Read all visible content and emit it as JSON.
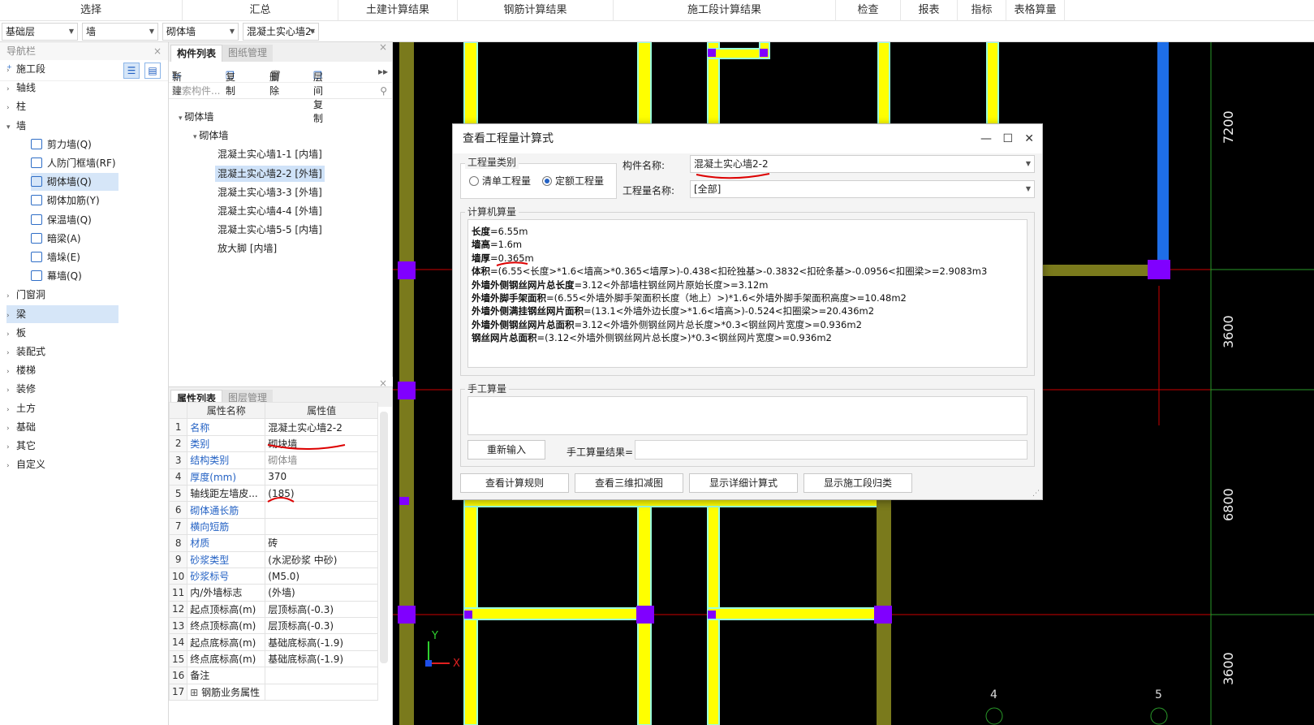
{
  "ribbon": [
    "选择",
    "汇总",
    "土建计算结果",
    "钢筋计算结果",
    "施工段计算结果",
    "检查",
    "报表",
    "指标",
    "表格算量"
  ],
  "selectors": [
    "基础层",
    "墙",
    "砌体墙",
    "混凝土实心墙2-"
  ],
  "nav": {
    "title": "导航栏",
    "items": [
      "施工段",
      "轴线",
      "柱",
      "墙",
      "剪力墙(Q)",
      "人防门框墙(RF)",
      "砌体墙(Q)",
      "砌体加筋(Y)",
      "保温墙(Q)",
      "暗梁(A)",
      "墙垛(E)",
      "幕墙(Q)",
      "门窗洞",
      "梁",
      "板",
      "装配式",
      "楼梯",
      "装修",
      "土方",
      "基础",
      "其它",
      "自定义"
    ]
  },
  "comp": {
    "tab_on": "构件列表",
    "tab_off": "图纸管理",
    "new": "新建",
    "copy": "复制",
    "delete": "删除",
    "floor_copy": "层间复制",
    "search_placeholder": "搜索构件...",
    "tree": [
      "砌体墙",
      "砌体墙",
      "混凝土实心墙1-1 [内墙]",
      "混凝土实心墙2-2 [外墙]",
      "混凝土实心墙3-3 [外墙]",
      "混凝土实心墙4-4 [外墙]",
      "混凝土实心墙5-5 [内墙]",
      "放大脚 [内墙]"
    ]
  },
  "prop": {
    "tab_on": "属性列表",
    "tab_off": "图层管理",
    "col_name": "属性名称",
    "col_value": "属性值",
    "rows": [
      {
        "n": "1",
        "name": "名称",
        "value": "混凝土实心墙2-2"
      },
      {
        "n": "2",
        "name": "类别",
        "value": "砌块墙"
      },
      {
        "n": "3",
        "name": "结构类别",
        "value": "砌体墙"
      },
      {
        "n": "4",
        "name": "厚度(mm)",
        "value": "370"
      },
      {
        "n": "5",
        "name": "轴线距左墙皮...",
        "value": "(185)"
      },
      {
        "n": "6",
        "name": "砌体通长筋",
        "value": ""
      },
      {
        "n": "7",
        "name": "横向短筋",
        "value": ""
      },
      {
        "n": "8",
        "name": "材质",
        "value": "砖"
      },
      {
        "n": "9",
        "name": "砂浆类型",
        "value": "(水泥砂浆 中砂)"
      },
      {
        "n": "10",
        "name": "砂浆标号",
        "value": "(M5.0)"
      },
      {
        "n": "11",
        "name": "内/外墙标志",
        "value": "(外墙)"
      },
      {
        "n": "12",
        "name": "起点顶标高(m)",
        "value": "层顶标高(-0.3)"
      },
      {
        "n": "13",
        "name": "终点顶标高(m)",
        "value": "层顶标高(-0.3)"
      },
      {
        "n": "14",
        "name": "起点底标高(m)",
        "value": "基础底标高(-1.9)"
      },
      {
        "n": "15",
        "name": "终点底标高(m)",
        "value": "基础底标高(-1.9)"
      },
      {
        "n": "16",
        "name": "备注",
        "value": ""
      },
      {
        "n": "17",
        "name": "钢筋业务属性",
        "value": ""
      }
    ]
  },
  "canvas": {
    "dims": [
      "7200",
      "3600",
      "6800",
      "3600"
    ],
    "axis_labels": [
      "4",
      "5"
    ],
    "axis_x": "X",
    "axis_y": "Y"
  },
  "dialog": {
    "title": "查看工程量计算式",
    "group_type": "工程量类别",
    "radio1": "清单工程量",
    "radio2": "定额工程量",
    "comp_name_label": "构件名称:",
    "comp_name_value": "混凝土实心墙2-2",
    "qty_name_label": "工程量名称:",
    "qty_name_value": "[全部]",
    "group_calc": "计算机算量",
    "calc_lines": [
      {
        "k": "长度",
        "v": "=6.55m"
      },
      {
        "k": "墙高",
        "v": "=1.6m"
      },
      {
        "k": "墙厚",
        "v": "=0.365m"
      },
      {
        "k": "体积",
        "v": "=(6.55<长度>*1.6<墙高>*0.365<墙厚>)-0.438<扣砼独基>-0.3832<扣砼条基>-0.0956<扣圈梁>=2.9083m3"
      },
      {
        "k": "外墙外侧钢丝网片总长度",
        "v": "=3.12<外部墙柱钢丝网片原始长度>=3.12m"
      },
      {
        "k": "外墙外脚手架面积",
        "v": "=(6.55<外墙外脚手架面积长度（地上）>)*1.6<外墙外脚手架面积高度>=10.48m2"
      },
      {
        "k": "外墙外侧满挂钢丝网片面积",
        "v": "=(13.1<外墙外边长度>*1.6<墙高>)-0.524<扣圈梁>=20.436m2"
      },
      {
        "k": "外墙外侧钢丝网片总面积",
        "v": "=3.12<外墙外侧钢丝网片总长度>*0.3<钢丝网片宽度>=0.936m2"
      },
      {
        "k": "钢丝网片总面积",
        "v": "=(3.12<外墙外侧钢丝网片总长度>)*0.3<钢丝网片宽度>=0.936m2"
      }
    ],
    "group_manual": "手工算量",
    "reinput": "重新输入",
    "manual_result_label": "手工算量结果=",
    "btn1": "查看计算规则",
    "btn2": "查看三维扣减图",
    "btn3": "显示详细计算式",
    "btn4": "显示施工段归类"
  }
}
